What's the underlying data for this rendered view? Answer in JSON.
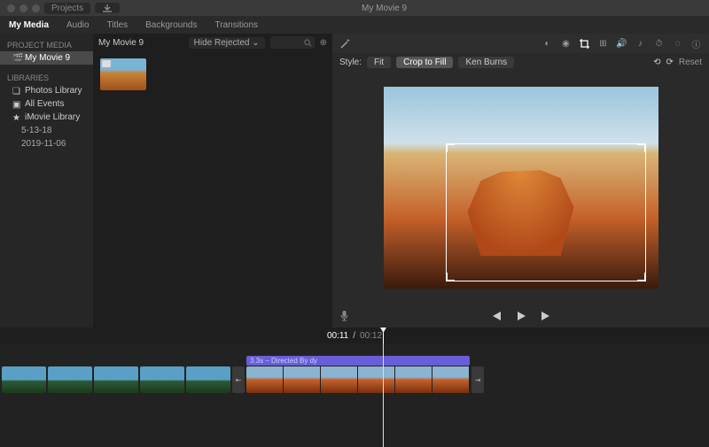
{
  "window": {
    "title": "My Movie 9",
    "back_label": "Projects"
  },
  "tabs": [
    "My Media",
    "Audio",
    "Titles",
    "Backgrounds",
    "Transitions"
  ],
  "active_tab": 0,
  "sidebar": {
    "project_hdr": "PROJECT MEDIA",
    "project": "My Movie 9",
    "libraries_hdr": "LIBRARIES",
    "items": [
      "Photos Library",
      "All Events",
      "iMovie Library"
    ],
    "subitems": [
      "5-13-18",
      "2019-11-06"
    ]
  },
  "browser": {
    "title": "My Movie 9",
    "filter": "Hide Rejected",
    "search_placeholder": ""
  },
  "viewer": {
    "style_label": "Style:",
    "styles": [
      "Fit",
      "Crop to Fill",
      "Ken Burns"
    ],
    "active_style": 1,
    "reset": "Reset"
  },
  "timecode": {
    "current": "00:11",
    "total": "00:12"
  },
  "timeline": {
    "title_clip": "3.3s – Directed By dy"
  }
}
